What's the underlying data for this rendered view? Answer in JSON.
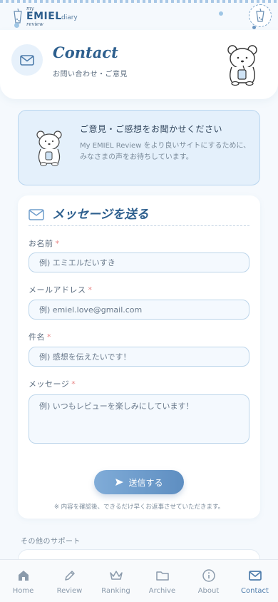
{
  "brand": {
    "my": "my",
    "name": "EMIEL",
    "diary": "diary",
    "review": "review"
  },
  "header": {
    "title": "Contact",
    "subtitle": "お問い合わせ・ご意見"
  },
  "intro": {
    "title": "ご意見・ご感想をお聞かせください",
    "body_line1": "My EMIEL Review をより良いサイトにするために、",
    "body_line2": "みなさまの声をお待ちしています。"
  },
  "form": {
    "title": "メッセージを送る",
    "required_mark": "*",
    "fields": {
      "name": {
        "label": "お名前",
        "placeholder": "例) エミエルだいすき"
      },
      "email": {
        "label": "メールアドレス",
        "placeholder": "例) emiel.love@gmail.com"
      },
      "subject": {
        "label": "件名",
        "placeholder": "例) 感想を伝えたいです！"
      },
      "message": {
        "label": "メッセージ",
        "placeholder": "例) いつもレビューを楽しみにしています！"
      }
    },
    "submit_label": "送信する",
    "note": "※ 内容を確認後、できるだけ早くお返事させていただきます。"
  },
  "support": {
    "label": "その他のサポート"
  },
  "nav": {
    "items": [
      {
        "label": "Home",
        "icon": "home-icon"
      },
      {
        "label": "Review",
        "icon": "pencil-icon"
      },
      {
        "label": "Ranking",
        "icon": "crown-icon"
      },
      {
        "label": "Archive",
        "icon": "folder-icon"
      },
      {
        "label": "About",
        "icon": "info-icon"
      },
      {
        "label": "Contact",
        "icon": "mail-icon"
      }
    ],
    "active": "Contact"
  },
  "colors": {
    "accent": "#2d5f8e",
    "button": "#6f9dcc",
    "required": "#e88484",
    "intro_bg": "#e4f0fb"
  }
}
